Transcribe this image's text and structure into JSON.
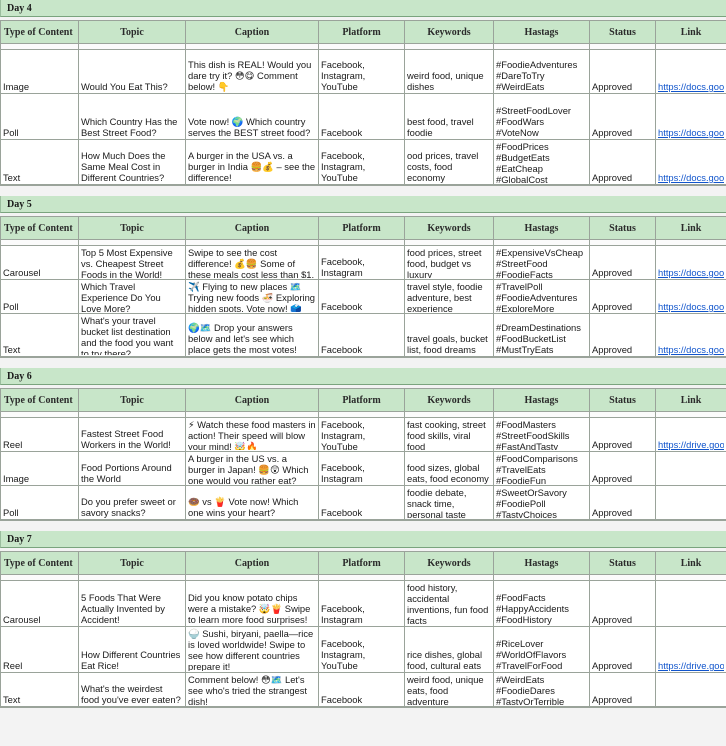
{
  "columns": [
    "Type of Content",
    "Topic",
    "Caption",
    "Platform",
    "Keywords",
    "Hastags",
    "Status",
    "Link"
  ],
  "days": [
    {
      "title": "Day 4",
      "rows": [
        {
          "type": "Image",
          "topic": "Would You Eat This?",
          "caption": "This dish is REAL! Would you dare try it? 😳😋 Comment below! 👇",
          "platform": "Facebook, Instagram, YouTube",
          "keywords": "weird food, unique dishes",
          "hashtags": "#FoodieAdventures #DareToTry #WeirdEats",
          "status": "Approved",
          "link": "https://docs.goo"
        },
        {
          "type": "Poll",
          "topic": "Which Country Has the Best Street Food?",
          "caption": "Vote now! 🌍 Which country serves the BEST street food?",
          "platform": "Facebook",
          "keywords": "best food, travel foodie",
          "hashtags": "#StreetFoodLover #FoodWars #VoteNow",
          "status": "Approved",
          "link": "https://docs.goo"
        },
        {
          "type": "Text",
          "topic": "How Much Does the Same Meal Cost in Different Countries?",
          "caption": "A burger in the USA vs. a burger in India 🍔💰 – see the difference!",
          "platform": "Facebook, Instagram, YouTube",
          "keywords": "ood prices, travel costs, food economy",
          "hashtags": "#FoodPrices #BudgetEats #EatCheap #GlobalCost",
          "status": "Approved",
          "link": "https://docs.goo"
        }
      ]
    },
    {
      "title": "Day 5",
      "rows": [
        {
          "type": "Carousel",
          "topic": "Top 5 Most Expensive vs. Cheapest Street Foods in the World!",
          "caption": "Swipe to see the cost difference! 💰🍔 Some of these meals cost less than $1, while others cost",
          "platform": "Facebook, Instagram",
          "keywords": "food prices, street food, budget vs luxury",
          "hashtags": "#ExpensiveVsCheap #StreetFood #FoodieFacts",
          "status": "Approved",
          "link": "https://docs.goo"
        },
        {
          "type": "Poll",
          "topic": "Which Travel Experience Do You Love More?",
          "caption": "✈️ Flying to new places 🗺️ Trying new foods 🍜 Exploring hidden spots. Vote now! 🗳️",
          "platform": "Facebook",
          "keywords": "travel style, foodie adventure, best experience",
          "hashtags": "#TravelPoll #FoodieAdventures #ExploreMore",
          "status": "Approved",
          "link": "https://docs.goo"
        },
        {
          "type": "Text",
          "topic": "What's your travel bucket list destination and the food you want to try there?",
          "caption": "🌍🗺️ Drop your answers below and let's see which place gets the most votes!",
          "platform": "Facebook",
          "keywords": "travel goals, bucket list, food dreams",
          "hashtags": "#DreamDestinations #FoodBucketList #MustTryEats",
          "status": "Approved",
          "link": "https://docs.goo"
        }
      ]
    },
    {
      "title": "Day 6",
      "rows": [
        {
          "type": "Reel",
          "topic": "Fastest Street Food Workers in the World!",
          "caption": "⚡ Watch these food masters in action! Their speed will blow your mind! 🤯🔥",
          "platform": "Facebook, Instagram, YouTube",
          "keywords": "fast cooking, street food skills, viral food",
          "hashtags": "#FoodMasters #StreetFoodSkills #FastAndTasty",
          "status": "Approved",
          "link": "https://drive.goo"
        },
        {
          "type": "Image",
          "topic": "Food Portions Around the World",
          "caption": "A burger in the US vs. a burger in Japan! 🍔😲 Which one would you rather eat?",
          "platform": "Facebook, Instagram",
          "keywords": "food sizes, global eats, food economy",
          "hashtags": "#FoodComparisons #TravelEats #FoodieFun",
          "status": "Approved",
          "link": ""
        },
        {
          "type": "Poll",
          "topic": "Do you prefer sweet or savory snacks?",
          "caption": "🍩 vs 🍟 Vote now! Which one wins your heart?",
          "platform": "Facebook",
          "keywords": "foodie debate, snack time, personal taste",
          "hashtags": "#SweetOrSavory #FoodiePoll #TastyChoices",
          "status": "Approved",
          "link": ""
        }
      ]
    },
    {
      "title": "Day 7",
      "rows": [
        {
          "type": "Carousel",
          "topic": "5 Foods That Were Actually Invented by Accident!",
          "caption": "Did you know potato chips were a mistake? 🤯🍟 Swipe to learn more food surprises!",
          "platform": "Facebook, Instagram",
          "keywords": "food history, accidental inventions, fun food facts",
          "hashtags": "#FoodFacts #HappyAccidents #FoodHistory",
          "status": "Approved",
          "link": ""
        },
        {
          "type": "Reel",
          "topic": "How Different Countries Eat Rice!",
          "caption": "🍚 Sushi, biryani, paella—rice is loved worldwide! Swipe to see how different countries prepare it!",
          "platform": "Facebook, Instagram, YouTube",
          "keywords": "rice dishes, global food, cultural eats",
          "hashtags": "#RiceLover #WorldOfFlavors #TravelForFood",
          "status": "Approved",
          "link": "https://drive.goo"
        },
        {
          "type": "Text",
          "topic": "What's the weirdest food you've ever eaten?",
          "caption": "Comment below! 😳🗺️ Let's see who's tried the strangest dish!",
          "platform": "Facebook",
          "keywords": "weird food, unique eats, food adventure",
          "hashtags": "#WeirdEats #FoodieDares #TastyOrTerrible",
          "status": "Approved",
          "link": ""
        }
      ]
    }
  ]
}
